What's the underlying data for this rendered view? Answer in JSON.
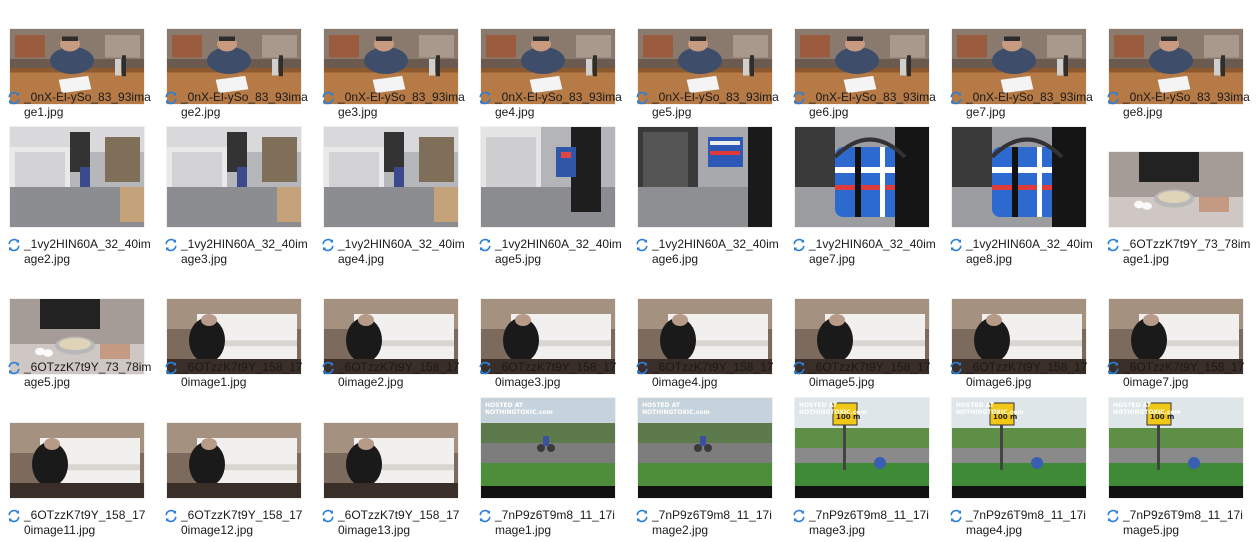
{
  "colors": {
    "sync_icon": "#2b7fd9",
    "text": "#1a1a1a",
    "background": "#ffffff"
  },
  "icons": {
    "sync": "sync-arrows-icon"
  },
  "files": [
    {
      "name": "_0nX-El-ySo_83_93image1.jpg",
      "scene": "desk"
    },
    {
      "name": "_0nX-El-ySo_83_93image2.jpg",
      "scene": "desk"
    },
    {
      "name": "_0nX-El-ySo_83_93image3.jpg",
      "scene": "desk"
    },
    {
      "name": "_0nX-El-ySo_83_93image4.jpg",
      "scene": "desk"
    },
    {
      "name": "_0nX-El-ySo_83_93image5.jpg",
      "scene": "desk"
    },
    {
      "name": "_0nX-El-ySo_83_93image6.jpg",
      "scene": "desk"
    },
    {
      "name": "_0nX-El-ySo_83_93image7.jpg",
      "scene": "desk"
    },
    {
      "name": "_0nX-El-ySo_83_93image8.jpg",
      "scene": "desk"
    },
    {
      "name": "_1vy2HIN60A_32_40image2.jpg",
      "scene": "office1"
    },
    {
      "name": "_1vy2HIN60A_32_40image3.jpg",
      "scene": "office1"
    },
    {
      "name": "_1vy2HIN60A_32_40image4.jpg",
      "scene": "office1"
    },
    {
      "name": "_1vy2HIN60A_32_40image5.jpg",
      "scene": "office2"
    },
    {
      "name": "_1vy2HIN60A_32_40image6.jpg",
      "scene": "office3"
    },
    {
      "name": "_1vy2HIN60A_32_40image7.jpg",
      "scene": "bag"
    },
    {
      "name": "_1vy2HIN60A_32_40image8.jpg",
      "scene": "bag"
    },
    {
      "name": "_6OTzzK7t9Y_73_78image1.jpg",
      "scene": "cooking"
    },
    {
      "name": "_6OTzzK7t9Y_73_78image5.jpg",
      "scene": "cooking"
    },
    {
      "name": "_6OTzzK7t9Y_158_170image1.jpg",
      "scene": "piano"
    },
    {
      "name": "_6OTzzK7t9Y_158_170image2.jpg",
      "scene": "piano"
    },
    {
      "name": "_6OTzzK7t9Y_158_170image3.jpg",
      "scene": "piano"
    },
    {
      "name": "_6OTzzK7t9Y_158_170image4.jpg",
      "scene": "piano"
    },
    {
      "name": "_6OTzzK7t9Y_158_170image5.jpg",
      "scene": "piano"
    },
    {
      "name": "_6OTzzK7t9Y_158_170image6.jpg",
      "scene": "piano"
    },
    {
      "name": "_6OTzzK7t9Y_158_170image7.jpg",
      "scene": "piano"
    },
    {
      "name": "_6OTzzK7t9Y_158_170image11.jpg",
      "scene": "piano"
    },
    {
      "name": "_6OTzzK7t9Y_158_170image12.jpg",
      "scene": "piano"
    },
    {
      "name": "_6OTzzK7t9Y_158_170image13.jpg",
      "scene": "piano"
    },
    {
      "name": "_7nP9z6T9m8_11_17image1.jpg",
      "scene": "road",
      "overlay": "HOSTED AT NOTHINGTOXIC.com"
    },
    {
      "name": "_7nP9z6T9m8_11_17image2.jpg",
      "scene": "road",
      "overlay": "HOSTED AT NOTHINGTOXIC.com"
    },
    {
      "name": "_7nP9z6T9m8_11_17image3.jpg",
      "scene": "roadsign",
      "overlay": "HOSTED AT NOTHINGTOXIC.com",
      "sign_text": "100 m"
    },
    {
      "name": "_7nP9z6T9m8_11_17image4.jpg",
      "scene": "roadsign",
      "overlay": "HOSTED AT NOTHINGTOXIC.com",
      "sign_text": "100 m"
    },
    {
      "name": "_7nP9z6T9m8_11_17image5.jpg",
      "scene": "roadsign",
      "overlay": "HOSTED AT NOTHINGTOXIC.com",
      "sign_text": "100 m"
    }
  ]
}
